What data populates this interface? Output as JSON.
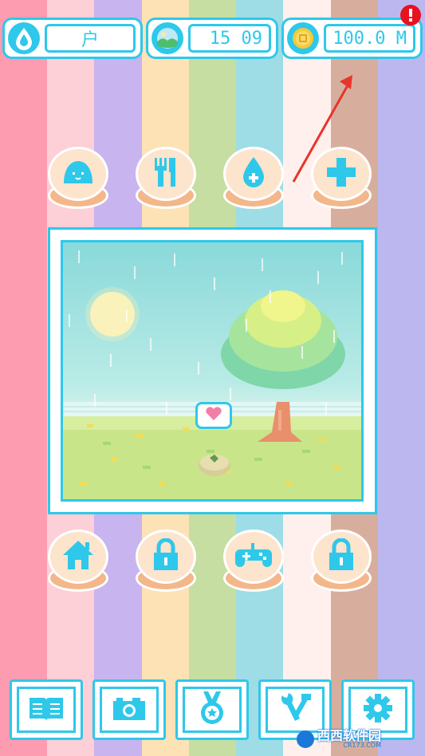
{
  "colors": {
    "stripes": [
      "#fd9bb0",
      "#fdcfd6",
      "#c8b4ef",
      "#fde2b6",
      "#c6dea2",
      "#9edde6",
      "#fff0ed",
      "#d7ae9e",
      "#bcb8ef"
    ],
    "accent": "#2ec8ea",
    "button_face": "#fde4cd",
    "button_base": "#f3b78a",
    "alert": "#e8111f"
  },
  "status_bar": {
    "water_icon": "water-drop-icon",
    "water_value": "户",
    "weather_icon": "landscape-icon",
    "time": "15 09",
    "coin_icon": "coin-icon",
    "coins": "100.0 M",
    "alert_icon": "exclamation-icon"
  },
  "actions_top": [
    {
      "icon": "slime-icon"
    },
    {
      "icon": "fork-knife-icon"
    },
    {
      "icon": "water-drop-plus-icon"
    },
    {
      "icon": "plus-icon"
    }
  ],
  "actions_bottom": [
    {
      "icon": "house-icon"
    },
    {
      "icon": "lock-icon"
    },
    {
      "icon": "gamepad-icon"
    },
    {
      "icon": "lock-icon"
    }
  ],
  "scene": {
    "bubble_icon": "heart-icon",
    "weather": "rain"
  },
  "toolbar": [
    {
      "icon": "book-icon"
    },
    {
      "icon": "camera-icon"
    },
    {
      "icon": "medal-icon"
    },
    {
      "icon": "tools-icon"
    },
    {
      "icon": "gear-icon"
    }
  ],
  "watermark": {
    "text": "西西软件园",
    "sub": "CR173.COM"
  }
}
